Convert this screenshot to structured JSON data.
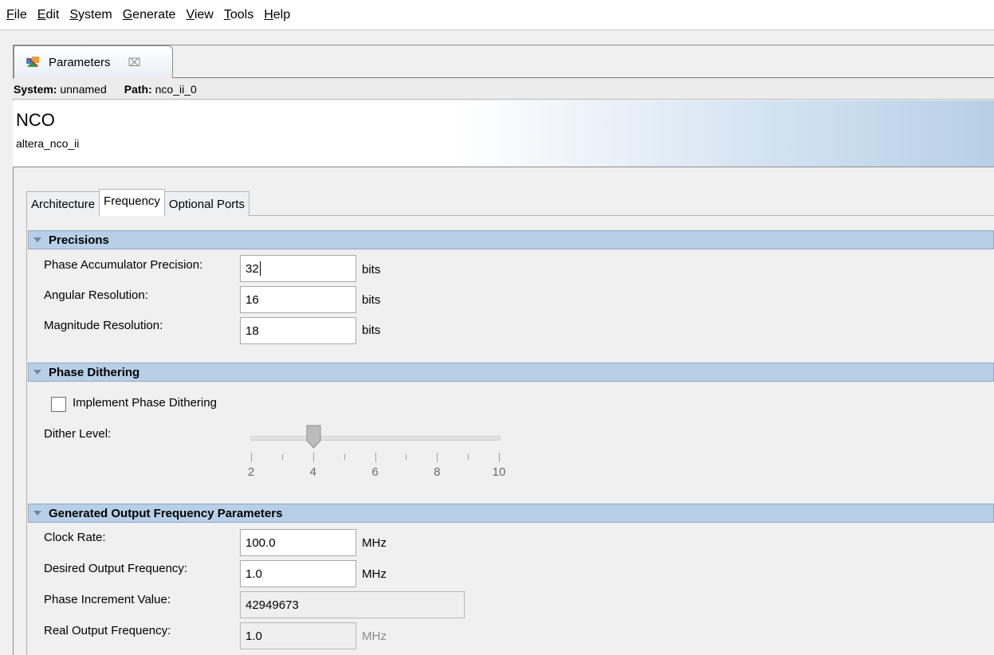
{
  "menu": [
    {
      "mn": "F",
      "rest": "ile"
    },
    {
      "mn": "E",
      "rest": "dit"
    },
    {
      "mn": "S",
      "rest": "ystem"
    },
    {
      "mn": "G",
      "rest": "enerate"
    },
    {
      "mn": "V",
      "rest": "iew"
    },
    {
      "mn": "T",
      "rest": "ools"
    },
    {
      "mn": "H",
      "rest": "elp"
    }
  ],
  "view_tab": {
    "label": "Parameters",
    "close": "⌧"
  },
  "pathbar": {
    "system_label": "System:",
    "system_value": "unnamed",
    "path_label": "Path:",
    "path_value": "nco_ii_0"
  },
  "header": {
    "title": "NCO",
    "subtitle": "altera_nco_ii"
  },
  "tabs": [
    "Architecture",
    "Frequency",
    "Optional Ports"
  ],
  "active_tab": "Frequency",
  "precisions": {
    "title": "Precisions",
    "rows": [
      {
        "label": "Phase Accumulator Precision:",
        "value": "32",
        "unit": "bits"
      },
      {
        "label": "Angular Resolution:",
        "value": "16",
        "unit": "bits"
      },
      {
        "label": "Magnitude Resolution:",
        "value": "18",
        "unit": "bits"
      }
    ]
  },
  "dithering": {
    "title": "Phase Dithering",
    "checkbox_label": "Implement Phase Dithering",
    "checked": false,
    "dither_label": "Dither Level:",
    "slider_min": 2,
    "slider_max": 10,
    "slider_value": 4,
    "tick_labels": [
      "2",
      "4",
      "6",
      "8",
      "10"
    ]
  },
  "output": {
    "title": "Generated Output Frequency Parameters",
    "rows": [
      {
        "label": "Clock Rate:",
        "value": "100.0",
        "unit": "MHz"
      },
      {
        "label": "Desired Output Frequency:",
        "value": "1.0",
        "unit": "MHz"
      },
      {
        "label": "Phase Increment Value:",
        "value": "42949673",
        "unit": ""
      },
      {
        "label": "Real Output Frequency:",
        "value": "1.0",
        "unit": "MHz"
      }
    ]
  }
}
